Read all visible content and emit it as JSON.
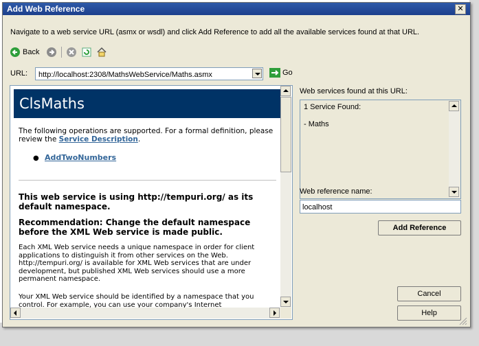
{
  "window": {
    "title": "Add Web Reference",
    "close_glyph": "✕"
  },
  "instructions": "Navigate to a web service URL (asmx or wsdl) and click Add Reference to add all the available services found at that URL.",
  "toolbar": {
    "back_label": "Back",
    "icons": [
      "back-arrow-icon",
      "forward-arrow-icon",
      "stop-icon",
      "refresh-icon",
      "home-icon"
    ]
  },
  "url": {
    "label": "URL:",
    "value": "http://localhost:2308/MathsWebService/Maths.asmx",
    "go_label": "Go"
  },
  "browser": {
    "header": "ClsMaths",
    "intro_prefix": "The following operations are supported. For a formal definition, please review the ",
    "service_description_link": "Service Description",
    "intro_suffix": ".",
    "operations": [
      "AddTwoNumbers"
    ],
    "namespace_heading": "This web service is using http://tempuri.org/ as its default namespace.",
    "recommendation_heading": "Recommendation: Change the default namespace before the XML Web service is made public.",
    "paragraph1": "Each XML Web service needs a unique namespace in order for client applications to distinguish it from other services on the Web. http://tempuri.org/ is available for XML Web services that are under development, but published XML Web services should use a more permanent namespace.",
    "paragraph2": "Your XML Web service should be identified by a namespace that you control. For example, you can use your company's Internet"
  },
  "services": {
    "label": "Web services found at this URL:",
    "found_text": "1 Service Found:",
    "items": [
      "- Maths"
    ]
  },
  "reference": {
    "label": "Web reference name:",
    "value": "localhost"
  },
  "buttons": {
    "add_reference": "Add Reference",
    "cancel": "Cancel",
    "help": "Help"
  },
  "colors": {
    "title_bar": "#1c3f8c",
    "dialog_bg": "#ece9d8",
    "page_header": "#003366",
    "link": "#336699"
  }
}
